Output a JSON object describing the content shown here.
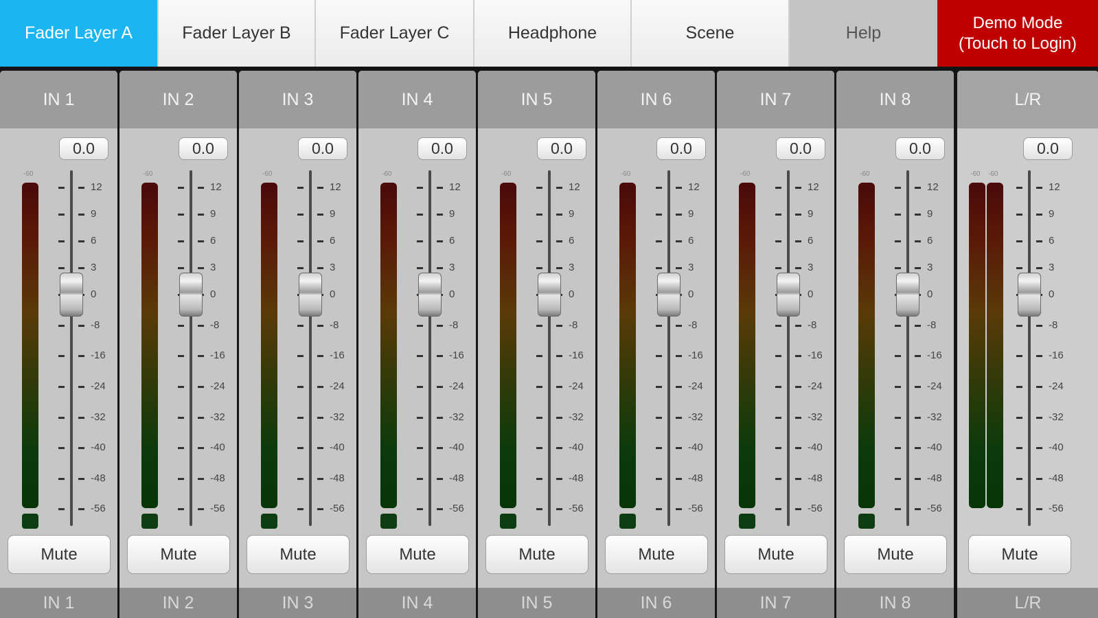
{
  "tabs": [
    {
      "label": "Fader Layer A",
      "active": true
    },
    {
      "label": "Fader Layer B"
    },
    {
      "label": "Fader Layer C"
    },
    {
      "label": "Headphone"
    },
    {
      "label": "Scene"
    },
    {
      "label": "Help"
    },
    {
      "label_line1": "Demo Mode",
      "label_line2": "(Touch to Login)"
    }
  ],
  "meter_label": "-60",
  "fader_scale": [
    "12",
    "9",
    "6",
    "3",
    "0",
    "-8",
    "-16",
    "-24",
    "-32",
    "-40",
    "-48",
    "-56"
  ],
  "channels": [
    {
      "name": "IN 1",
      "gain": "0.0",
      "mute_label": "Mute",
      "footer": "IN 1",
      "fader_db": 0
    },
    {
      "name": "IN 2",
      "gain": "0.0",
      "mute_label": "Mute",
      "footer": "IN 2",
      "fader_db": 0
    },
    {
      "name": "IN 3",
      "gain": "0.0",
      "mute_label": "Mute",
      "footer": "IN 3",
      "fader_db": 0
    },
    {
      "name": "IN 4",
      "gain": "0.0",
      "mute_label": "Mute",
      "footer": "IN 4",
      "fader_db": 0
    },
    {
      "name": "IN 5",
      "gain": "0.0",
      "mute_label": "Mute",
      "footer": "IN 5",
      "fader_db": 0
    },
    {
      "name": "IN 6",
      "gain": "0.0",
      "mute_label": "Mute",
      "footer": "IN 6",
      "fader_db": 0
    },
    {
      "name": "IN 7",
      "gain": "0.0",
      "mute_label": "Mute",
      "footer": "IN 7",
      "fader_db": 0
    },
    {
      "name": "IN 8",
      "gain": "0.0",
      "mute_label": "Mute",
      "footer": "IN 8",
      "fader_db": 0
    }
  ],
  "master": {
    "name": "L/R",
    "gain": "0.0",
    "mute_label": "Mute",
    "footer": "L/R",
    "fader_db": 0
  },
  "colors": {
    "active_tab": "#1bb5f2",
    "demo_tab": "#c00000"
  }
}
